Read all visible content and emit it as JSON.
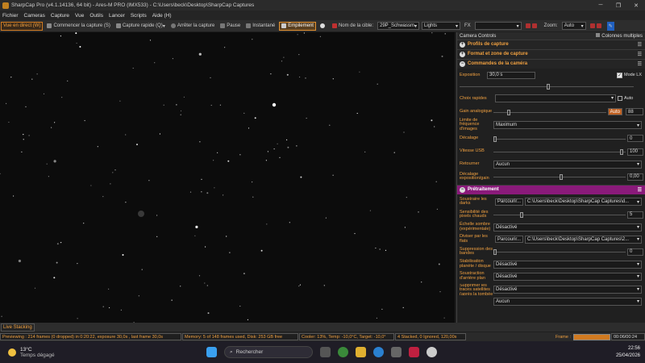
{
  "window": {
    "title": "SharpCap Pro (v4.1.14136, 64 bit) - Ares-M PRO (IMX533) - C:\\Users\\beck\\Desktop\\SharpCap Captures"
  },
  "menu": [
    "Fichier",
    "Cameras",
    "Capture",
    "Vue",
    "Outils",
    "Lancer",
    "Scripts",
    "Aide (H)"
  ],
  "toolbar": {
    "live_view": "Vue en direct (W)",
    "start_capture": "Commencer la capture (S)",
    "quick_capture": "Capture rapide (Q)",
    "stop_capture": "Arrêter la capture",
    "pause": "Pause",
    "snapshot": "Instantané",
    "stacking": "Empilement",
    "target_label": "Nom de la cible:",
    "target_value": "29P_Schwassm",
    "frame_type": "Lights",
    "fx_label": "FX",
    "fx_value": "",
    "zoom_label": "Zoom:",
    "zoom_value": "Auto"
  },
  "panel": {
    "header": "Camera Controls",
    "multi_col": "Colonnes multiples",
    "sections": {
      "profiles": "Profils de capture",
      "format": "Format et zone de capture",
      "camera": "Commandes de la caméra",
      "preprocessing": "Prétraitement"
    },
    "exposure_label": "Exposition",
    "exposure_value": "30,0 s",
    "lx_mode": "Mode LX",
    "quick_choice": "Choix rapides",
    "auto": "Auto",
    "gain_label": "Gain analogique",
    "gain_auto": "Auto",
    "gain_value": "88",
    "frame_limit_label": "Limite de fréquence d'images",
    "frame_limit_value": "Maximum",
    "offset_label": "Décalage",
    "offset_value": "0",
    "usb_label": "Vitesse USB",
    "usb_value": "100",
    "flip_label": "Retourner",
    "flip_value": "Aucun",
    "exp_offset_label": "Décalage exposition/gain",
    "exp_offset_value": "0,00",
    "darks_label": "Soustraire les darks",
    "browse": "Parcourir...",
    "darks_path": "C:\\Users\\beck\\Desktop\\SharpCap Captures\\d...",
    "hotpix_label": "Sensibilité des pixels chauds",
    "hotpix_value": "5",
    "darkscale_label": "Échelle sombre (expérimentale)",
    "disabled": "Désactivé",
    "flats_label": "Diviser par les flats",
    "flats_path": "C:\\Users\\beck\\Desktop\\SharpCap Captures\\2...",
    "banding_label": "Suppression des bandes",
    "banding_value": "0",
    "planet_label": "Stabilisation planète / disque",
    "bg_label": "Soustraction d'arrière plan",
    "sat_label": "Supprimer les traces satellites (après la tombée de la nuit plat)",
    "none": "Aucun"
  },
  "status": {
    "live_stacking": "Live Stacking",
    "previewing": "Previewing : 214 frames (0 dropped) in 0:20:22, exposure 30,0s , last frame 30,0s",
    "memory": "Memory: 5 of 148 frames used, Disk: 253 GB free",
    "cooler": "Cooler: 13%, Temp: -10,0°C, Target: -10,0°",
    "stacked": "4 Stacked, 0 Ignored, 120,00s",
    "frame_label": "Frame :",
    "frame_time": "00:06/00:24"
  },
  "taskbar": {
    "temp": "13°C",
    "weather": "Temps dégagé",
    "search": "Rechercher",
    "time": "22:56",
    "date": "25/04/2026"
  }
}
